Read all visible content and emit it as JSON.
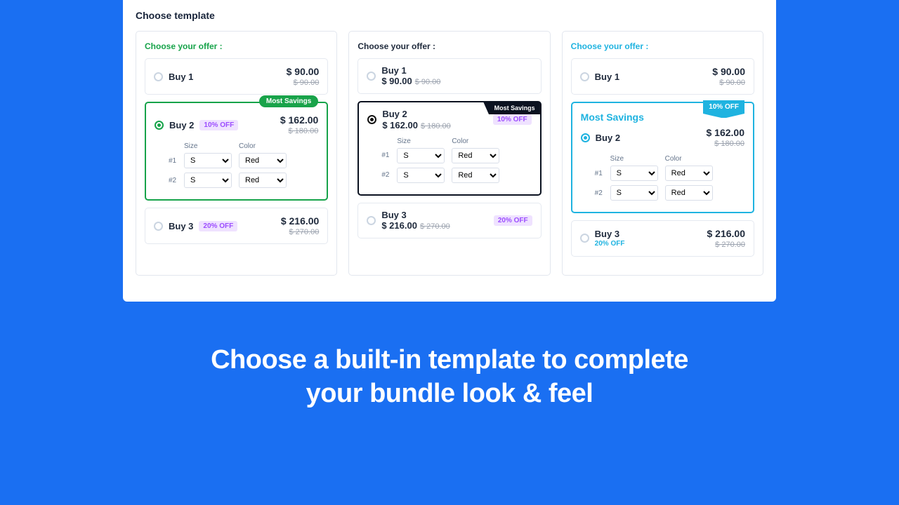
{
  "panel_title": "Choose template",
  "choose_label": "Choose your offer :",
  "savings_label": "Most Savings",
  "variant_headers": {
    "size": "Size",
    "color": "Color"
  },
  "row_idx": {
    "one": "#1",
    "two": "#2"
  },
  "opts": {
    "size": "S",
    "color": "Red"
  },
  "offers": {
    "buy1": {
      "name": "Buy 1",
      "price": "$ 90.00",
      "strike": "$ 90.00"
    },
    "buy2": {
      "name": "Buy 2",
      "price": "$ 162.00",
      "strike": "$ 180.00",
      "discount": "10% OFF"
    },
    "buy3": {
      "name": "Buy 3",
      "price": "$ 216.00",
      "strike": "$ 270.00",
      "discount": "20% OFF"
    }
  },
  "caption_line1": "Choose a built-in template to complete",
  "caption_line2": "your bundle look & feel"
}
